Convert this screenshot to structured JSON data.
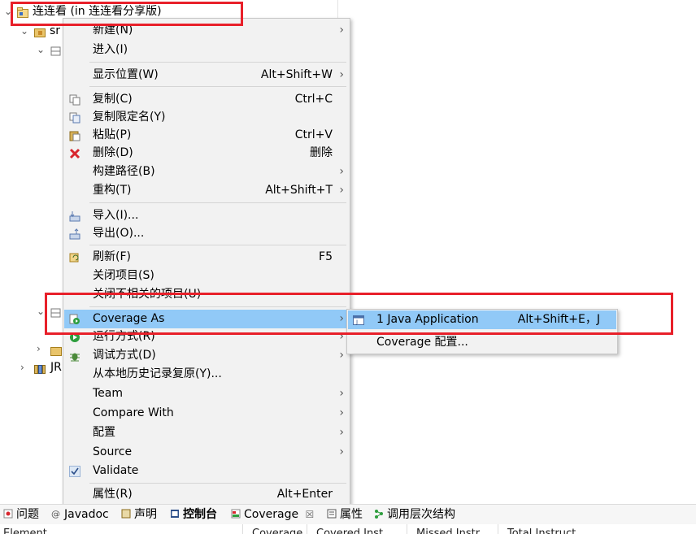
{
  "tree": {
    "project_label": "连连看 (in 连连看分享版)",
    "src_label": "sr",
    "jre_label": "JR"
  },
  "context_menu": {
    "new": {
      "label": "新建(N)"
    },
    "go_into": {
      "label": "进入(I)"
    },
    "show_in": {
      "label": "显示位置(W)",
      "accel": "Alt+Shift+W"
    },
    "copy": {
      "label": "复制(C)",
      "accel": "Ctrl+C"
    },
    "copy_qualified": {
      "label": "复制限定名(Y)"
    },
    "paste": {
      "label": "粘贴(P)",
      "accel": "Ctrl+V"
    },
    "delete": {
      "label": "删除(D)",
      "accel": "删除"
    },
    "build_path": {
      "label": "构建路径(B)"
    },
    "refactor": {
      "label": "重构(T)",
      "accel": "Alt+Shift+T"
    },
    "import": {
      "label": "导入(I)..."
    },
    "export": {
      "label": "导出(O)..."
    },
    "refresh": {
      "label": "刷新(F)",
      "accel": "F5"
    },
    "close_project": {
      "label": "关闭项目(S)"
    },
    "close_unrelated": {
      "label": "关闭不相关的项目(U)"
    },
    "coverage_as": {
      "label": "Coverage As"
    },
    "run_as": {
      "label": "运行方式(R)"
    },
    "debug_as": {
      "label": "调试方式(D)"
    },
    "restore_history": {
      "label": "从本地历史记录复原(Y)..."
    },
    "team": {
      "label": "Team"
    },
    "compare_with": {
      "label": "Compare With"
    },
    "configure": {
      "label": "配置"
    },
    "source": {
      "label": "Source"
    },
    "validate": {
      "label": "Validate"
    },
    "properties": {
      "label": "属性(R)",
      "accel": "Alt+Enter"
    }
  },
  "submenu": {
    "java_app": {
      "label": "1 Java Application",
      "accel": "Alt+Shift+E，J"
    },
    "coverage_config": {
      "label": "Coverage 配置..."
    }
  },
  "bottom_tabs": [
    {
      "label": "问题"
    },
    {
      "label": "Javadoc"
    },
    {
      "label": "声明"
    },
    {
      "label": "控制台"
    },
    {
      "label": "Coverage"
    },
    {
      "label": "属性"
    },
    {
      "label": "调用层次结构"
    }
  ],
  "coverage_close": "☒",
  "table_headers": [
    "Element",
    "Coverage",
    "Covered Inst...",
    "Missed Instr...",
    "Total Instruct..."
  ],
  "colors": {
    "highlight": "#91c9f7",
    "annotation_red": "#e8202a",
    "menu_bg": "#f2f2f2"
  }
}
